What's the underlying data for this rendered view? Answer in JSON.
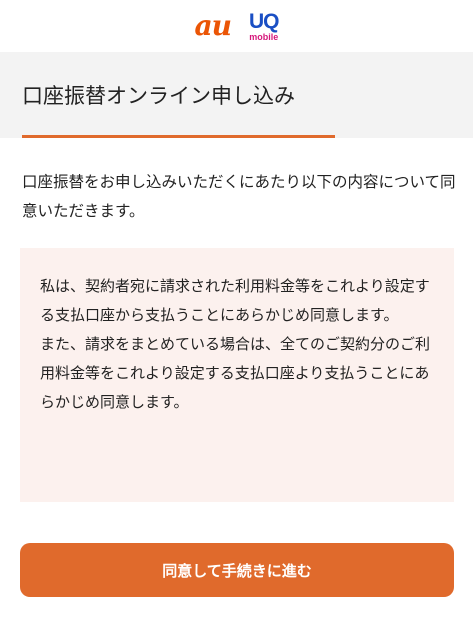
{
  "header": {
    "au_logo_text": "au",
    "uq_logo_mark": "UQ",
    "uq_logo_sub": "mobile"
  },
  "page": {
    "title": "口座振替オンライン申し込み"
  },
  "intro": {
    "text": "口座振替をお申し込みいただくにあたり以下の内容について同意いただきます。"
  },
  "agreement": {
    "text": "私は、契約者宛に請求された利用料金等をこれより設定する支払口座から支払うことにあらかじめ同意します。\nまた、請求をまとめている場合は、全てのご契約分のご利用料金等をこれより設定する支払口座より支払うことにあらかじめ同意します。"
  },
  "actions": {
    "agree_label": "同意して手続きに進む"
  },
  "colors": {
    "accent": "#e06a2c",
    "au_brand": "#eb5505",
    "uq_blue": "#1a4fc4",
    "uq_pink": "#d6177b",
    "title_bar_bg": "#f3f3f3",
    "agreement_bg": "#fcf1ee"
  }
}
